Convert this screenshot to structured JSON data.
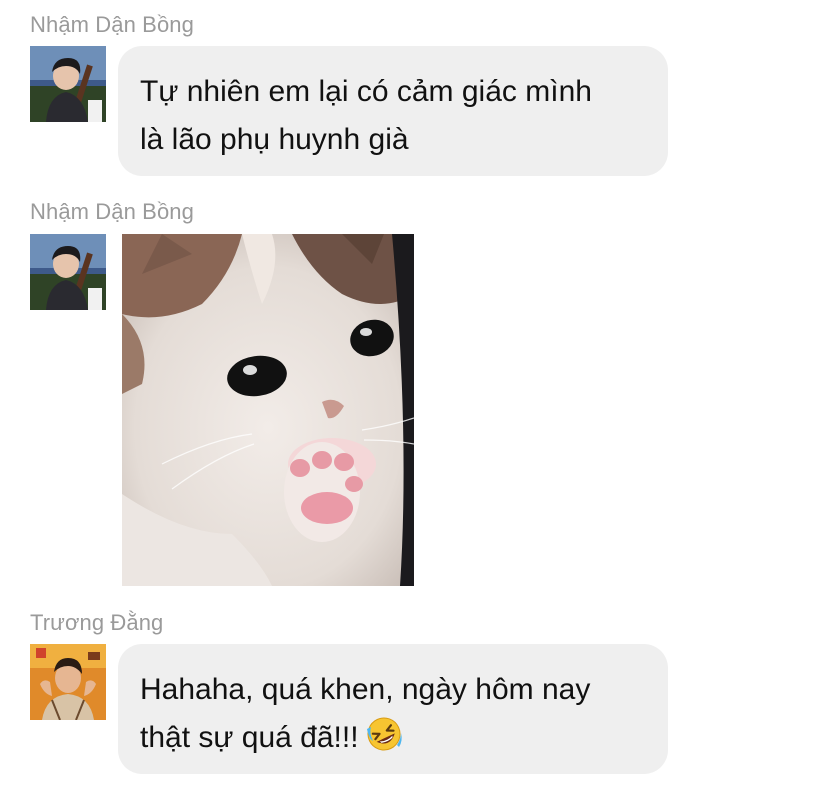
{
  "messages": [
    {
      "sender": "Nhậm Dận Bồng",
      "lines": [
        "Tự nhiên em lại có cảm giác mình",
        "là lão phụ huynh già"
      ]
    },
    {
      "sender": "Nhậm Dận Bồng",
      "image": "crying-cat-meme"
    },
    {
      "sender": "Trương Đằng",
      "lines": [
        "Hahaha, quá khen, ngày hôm nay",
        "thật sự quá đã!!!"
      ],
      "emoji": "rolling-on-floor-laughing"
    }
  ],
  "colors": {
    "bubble": "#efefef",
    "sender_text": "#9a9a9a",
    "message_text": "#111111"
  }
}
